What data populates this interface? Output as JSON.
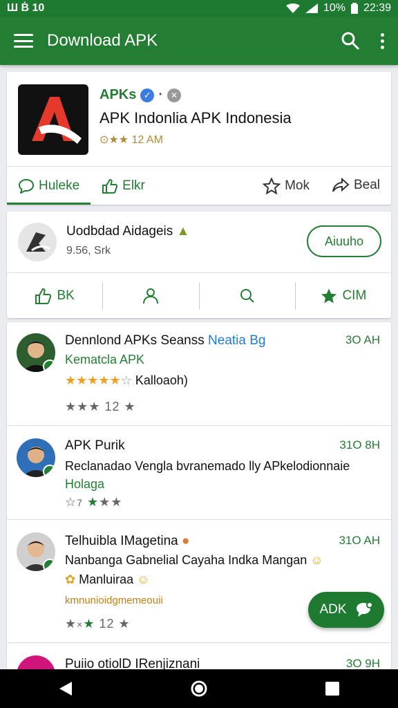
{
  "status_bar": {
    "left_text": "Ш Ḃ 10",
    "battery": "10%",
    "time": "22:39"
  },
  "app_bar": {
    "title": "Download APK"
  },
  "app_card": {
    "name": "APKs",
    "subtitle": "APK Indonlia APK Indonesia",
    "meta": "12 AM",
    "tabs": [
      {
        "label": "Huleke"
      },
      {
        "label": "Elkr"
      },
      {
        "label": "Mok"
      },
      {
        "label": "Beal"
      }
    ]
  },
  "developer": {
    "name": "Uodbdad Aidageis",
    "sub": "9.56, Srk",
    "follow_label": "Aiuuho",
    "actions": [
      {
        "label": "BK"
      },
      {
        "label": ""
      },
      {
        "label": ""
      },
      {
        "label": "CIM"
      }
    ]
  },
  "reviews": [
    {
      "name": "Dennlond APKs Seanss",
      "tag": "Neatia Bg",
      "time": "3O AH",
      "line1": "Kematcla APK",
      "line2": "Kalloaoh)",
      "stars_count": "12",
      "rating": 4.5
    },
    {
      "name": "APK Purik",
      "tag": "",
      "time": "31O 8H",
      "line1": "Reclanadao Vengla bvranemado lly APkelodionnaie",
      "line2": "Holaga",
      "stars_count": "",
      "rating": 3
    },
    {
      "name": "Telhuibla IMagetina",
      "tag": "",
      "time": "31O AH",
      "line1": "Nanbanga Gabnelial Cayaha Indka Mangan",
      "line2": "Manluiraa",
      "line3": "kmnunioidgmemeouii",
      "stars_count": "12",
      "rating": 3
    },
    {
      "name": "Puiio otiolD IRenjiznani",
      "tag": "",
      "time": "3O 9H",
      "line1": "",
      "line2": "",
      "stars_count": "",
      "rating": 0
    }
  ],
  "fab": {
    "label": "ADK"
  },
  "colors": {
    "primary": "#237d33",
    "accent": "#1e7cd6",
    "star": "#f0a020"
  }
}
